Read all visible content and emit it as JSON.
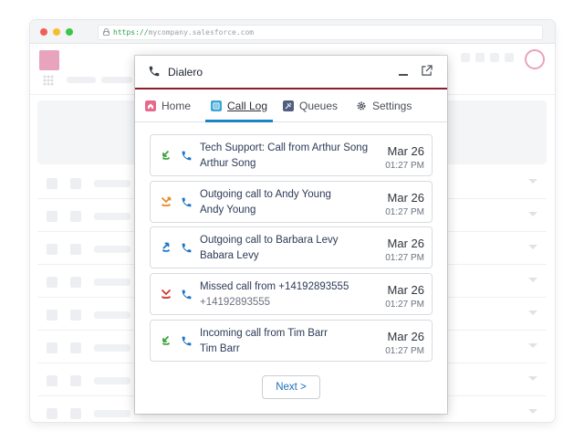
{
  "browser": {
    "url_scheme": "https://",
    "url_host": "mycompany.salesforce.com"
  },
  "dialer": {
    "title": "Dialero",
    "tabs": [
      {
        "label": "Home",
        "icon": "home-icon",
        "active": false
      },
      {
        "label": "Call Log",
        "icon": "call-log-icon",
        "active": true
      },
      {
        "label": "Queues",
        "icon": "queues-icon",
        "active": false
      },
      {
        "label": "Settings",
        "icon": "gear-icon",
        "active": false
      }
    ],
    "calls": [
      {
        "status": "inbound",
        "title": "Tech Support: Call from Arthur Song",
        "subtitle": "Arthur Song",
        "date": "Mar 26",
        "time": "01:27 PM"
      },
      {
        "status": "outbound",
        "title": "Outgoing call to Andy Young",
        "subtitle": "Andy Young",
        "date": "Mar 26",
        "time": "01:27 PM"
      },
      {
        "status": "outbound-answered",
        "title": "Outgoing call to Barbara Levy",
        "subtitle": "Babara Levy",
        "date": "Mar 26",
        "time": "01:27 PM"
      },
      {
        "status": "missed",
        "title": "Missed call from +14192893555",
        "subtitle": "+14192893555",
        "date": "Mar 26",
        "time": "01:27 PM"
      },
      {
        "status": "inbound",
        "title": "Incoming call from Tim Barr",
        "subtitle": "Tim Barr",
        "date": "Mar 26",
        "time": "01:27 PM"
      }
    ],
    "next_label": "Next >"
  },
  "colors": {
    "header_accent": "#8e1b2c",
    "tab_active": "#1b84c8",
    "inbound": "#3aa33a",
    "outbound": "#e98a2b",
    "missed": "#d0342c",
    "phone_blue": "#1b74c8"
  }
}
